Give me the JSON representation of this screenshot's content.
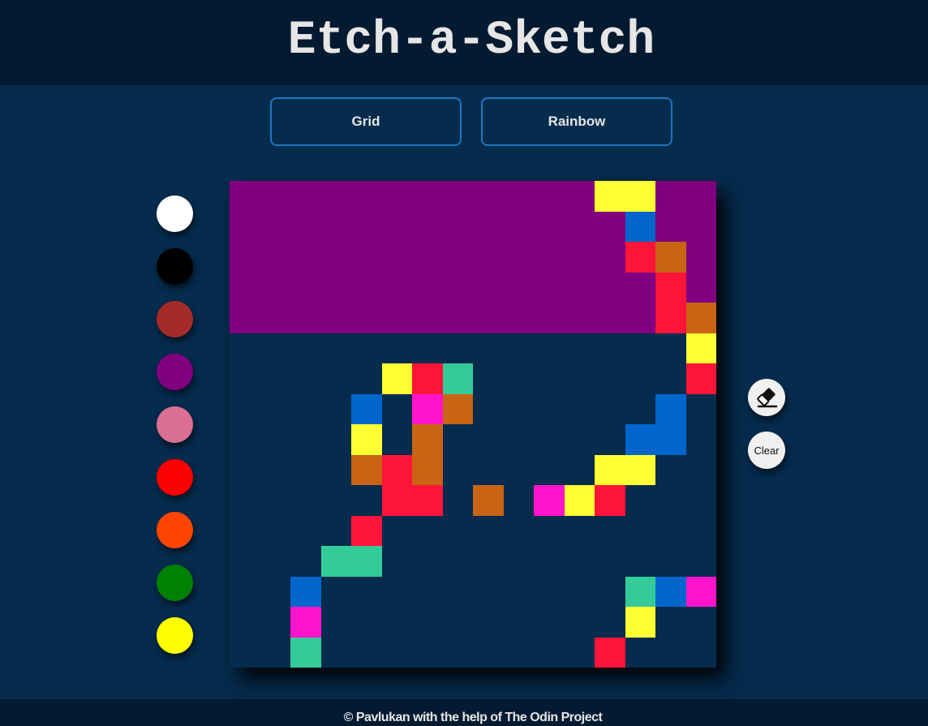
{
  "app": {
    "title": "Etch-a-Sketch"
  },
  "controls": {
    "grid_label": "Grid",
    "rainbow_label": "Rainbow",
    "clear_label": "Clear"
  },
  "palette": [
    {
      "name": "white",
      "color": "#ffffff"
    },
    {
      "name": "black",
      "color": "#000000"
    },
    {
      "name": "brown",
      "color": "#a52a2a"
    },
    {
      "name": "purple",
      "color": "#800080"
    },
    {
      "name": "pink",
      "color": "#db7093"
    },
    {
      "name": "red",
      "color": "#ff0000"
    },
    {
      "name": "orange-red",
      "color": "#ff4500"
    },
    {
      "name": "green",
      "color": "#008000"
    },
    {
      "name": "yellow",
      "color": "#ffff00"
    }
  ],
  "grid": {
    "size": 16,
    "background": "#052b4d",
    "fill_color": "#800080",
    "filled_region": {
      "col_start": 0,
      "col_end": 14,
      "row_start": 0,
      "row_end": 5
    },
    "cells": [
      {
        "c": 12,
        "r": 0,
        "color": "#ffff33"
      },
      {
        "c": 13,
        "r": 0,
        "color": "#ffff33"
      },
      {
        "c": 13,
        "r": 1,
        "color": "#0066cc"
      },
      {
        "c": 13,
        "r": 2,
        "color": "#ff1439"
      },
      {
        "c": 14,
        "r": 2,
        "color": "#c86414"
      },
      {
        "c": 14,
        "r": 3,
        "color": "#ff1439"
      },
      {
        "c": 14,
        "r": 4,
        "color": "#ff1439"
      },
      {
        "c": 15,
        "r": 4,
        "color": "#c86414"
      },
      {
        "c": 15,
        "r": 5,
        "color": "#ffff33"
      },
      {
        "c": 15,
        "r": 6,
        "color": "#ff1439"
      },
      {
        "c": 5,
        "r": 6,
        "color": "#ffff33"
      },
      {
        "c": 6,
        "r": 6,
        "color": "#ff1439"
      },
      {
        "c": 7,
        "r": 6,
        "color": "#33cc99"
      },
      {
        "c": 4,
        "r": 7,
        "color": "#0066cc"
      },
      {
        "c": 6,
        "r": 7,
        "color": "#ff14cc"
      },
      {
        "c": 7,
        "r": 7,
        "color": "#c86414"
      },
      {
        "c": 14,
        "r": 7,
        "color": "#0066cc"
      },
      {
        "c": 4,
        "r": 8,
        "color": "#ffff33"
      },
      {
        "c": 6,
        "r": 8,
        "color": "#c86414"
      },
      {
        "c": 13,
        "r": 8,
        "color": "#0066cc"
      },
      {
        "c": 14,
        "r": 8,
        "color": "#0066cc"
      },
      {
        "c": 4,
        "r": 9,
        "color": "#c86414"
      },
      {
        "c": 5,
        "r": 9,
        "color": "#ff1439"
      },
      {
        "c": 6,
        "r": 9,
        "color": "#c86414"
      },
      {
        "c": 12,
        "r": 9,
        "color": "#ffff33"
      },
      {
        "c": 13,
        "r": 9,
        "color": "#ffff33"
      },
      {
        "c": 5,
        "r": 10,
        "color": "#ff1439"
      },
      {
        "c": 6,
        "r": 10,
        "color": "#ff1439"
      },
      {
        "c": 8,
        "r": 10,
        "color": "#c86414"
      },
      {
        "c": 10,
        "r": 10,
        "color": "#ff14cc"
      },
      {
        "c": 11,
        "r": 10,
        "color": "#ffff33"
      },
      {
        "c": 12,
        "r": 10,
        "color": "#ff1439"
      },
      {
        "c": 4,
        "r": 11,
        "color": "#ff1439"
      },
      {
        "c": 3,
        "r": 12,
        "color": "#33cc99"
      },
      {
        "c": 4,
        "r": 12,
        "color": "#33cc99"
      },
      {
        "c": 2,
        "r": 13,
        "color": "#0066cc"
      },
      {
        "c": 13,
        "r": 13,
        "color": "#33cc99"
      },
      {
        "c": 14,
        "r": 13,
        "color": "#0066cc"
      },
      {
        "c": 15,
        "r": 13,
        "color": "#ff14cc"
      },
      {
        "c": 2,
        "r": 14,
        "color": "#ff14cc"
      },
      {
        "c": 13,
        "r": 14,
        "color": "#ffff33"
      },
      {
        "c": 2,
        "r": 15,
        "color": "#33cc99"
      },
      {
        "c": 12,
        "r": 15,
        "color": "#ff1439"
      }
    ]
  },
  "tools": {
    "eraser_icon": "eraser-icon"
  },
  "footer": {
    "text": "© Pavlukan with the help of  The Odin Project"
  }
}
